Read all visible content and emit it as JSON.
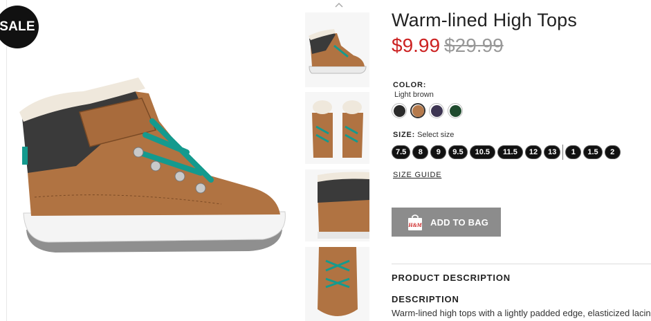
{
  "badge": {
    "label": "SALE"
  },
  "product": {
    "title": "Warm-lined High Tops",
    "price_sale": "$9.99",
    "price_original": "$29.99"
  },
  "color": {
    "label": "COLOR:",
    "selected": "Light brown",
    "swatches": [
      {
        "name": "black",
        "hex": "#2b2b2b"
      },
      {
        "name": "light-brown",
        "hex": "#b57a4c"
      },
      {
        "name": "dark-purple",
        "hex": "#3d3552"
      },
      {
        "name": "dark-green",
        "hex": "#1f4b2e"
      }
    ]
  },
  "size": {
    "label": "SIZE:",
    "placeholder": "Select size",
    "options": [
      "7.5",
      "8",
      "9",
      "9.5",
      "10.5",
      "11.5",
      "12",
      "13",
      "1",
      "1.5",
      "2"
    ]
  },
  "size_guide": "SIZE GUIDE",
  "add_to_bag": {
    "label": "ADD TO BAG",
    "brand": "H&M"
  },
  "product_description_heading": "PRODUCT DESCRIPTION",
  "description": {
    "heading": "DESCRIPTION",
    "text": "Warm-lined high tops with a lightly padded edge, elasticized lacing"
  },
  "colors": {
    "sale_red": "#cc2222",
    "button_gray": "#8c8c8c",
    "badge_black": "#111111"
  }
}
